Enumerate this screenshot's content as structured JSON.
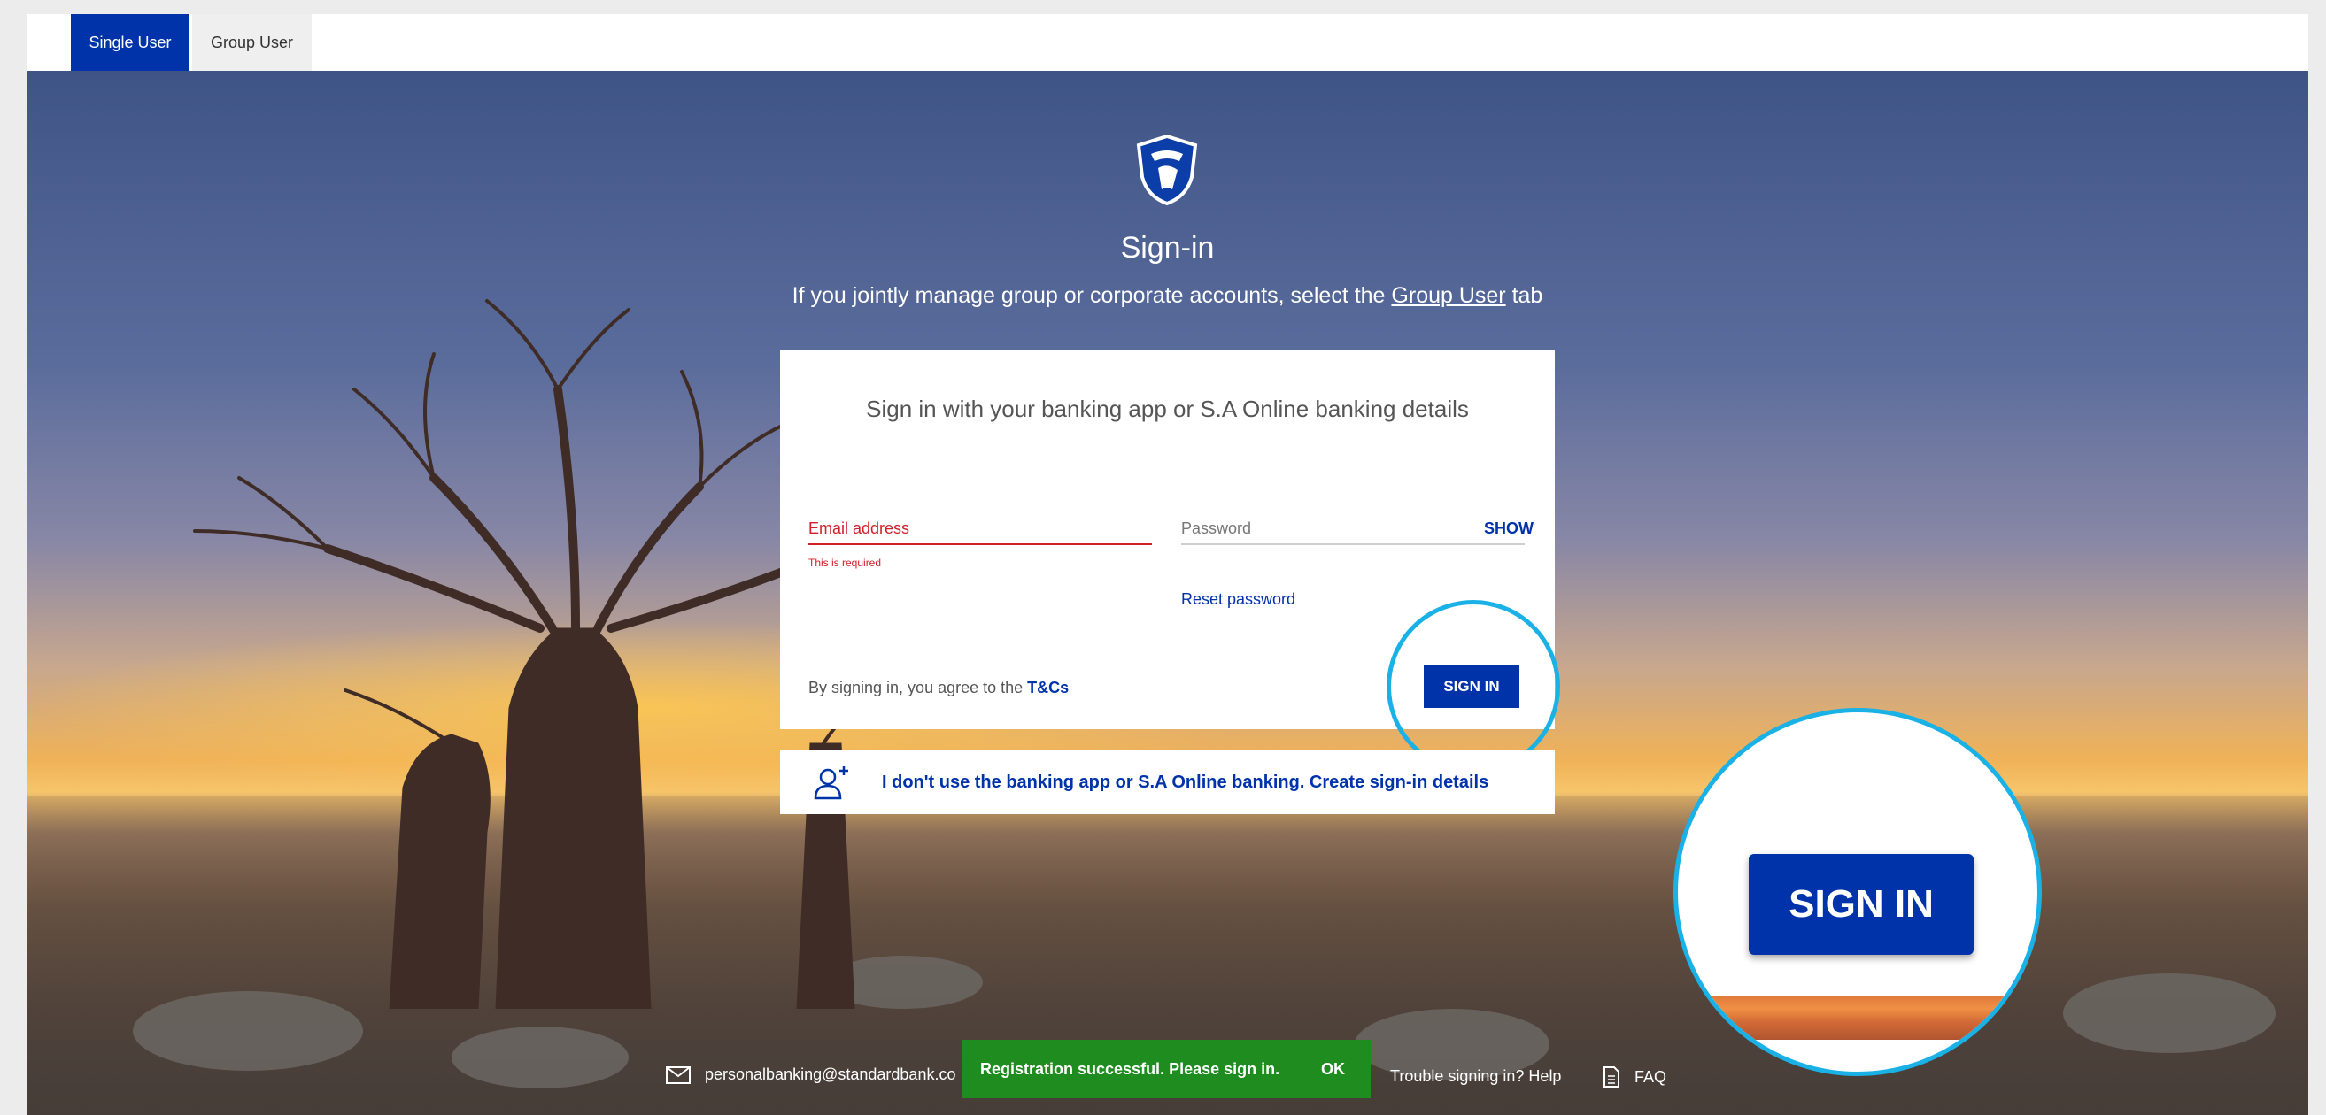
{
  "tabs": {
    "single_user": "Single User",
    "group_user": "Group User"
  },
  "header": {
    "title": "Sign-in",
    "subtitle_prefix": "If you jointly manage group or corporate accounts, select the ",
    "subtitle_link": "Group User",
    "subtitle_suffix": " tab"
  },
  "card": {
    "heading": "Sign in with your banking app or S.A Online banking details",
    "email_label": "Email address",
    "email_error": "This is required",
    "password_label": "Password",
    "show_label": "SHOW",
    "reset_label": "Reset password",
    "terms_prefix": "By signing in, you agree to the ",
    "terms_link": "T&Cs",
    "signin_label": "SIGN IN"
  },
  "create": {
    "label": "I don't use the banking app or S.A Online banking. Create sign-in details"
  },
  "zoom": {
    "label": "SIGN IN"
  },
  "footer": {
    "email": "personalbanking@standardbank.co",
    "trouble": "Trouble signing in? Help",
    "faq": "FAQ"
  },
  "toast": {
    "message": "Registration successful. Please sign in.",
    "ok": "OK"
  },
  "colors": {
    "brand_blue": "#0033aa",
    "error_red": "#d0202a",
    "highlight_cyan": "#1ab1e6",
    "toast_green": "#1e8c1e"
  },
  "icons": {
    "logo": "shield-logo-icon",
    "create": "add-user-icon",
    "email": "envelope-icon",
    "help": "help-icon",
    "faq": "document-icon"
  }
}
